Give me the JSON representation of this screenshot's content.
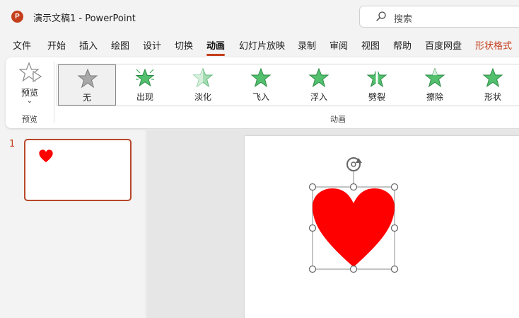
{
  "window": {
    "app_logo": "P",
    "title": "演示文稿1  -  PowerPoint"
  },
  "search": {
    "placeholder": "搜索",
    "icon": "search-icon"
  },
  "menu": {
    "tabs": [
      {
        "label": "文件"
      },
      {
        "label": "开始"
      },
      {
        "label": "插入"
      },
      {
        "label": "绘图"
      },
      {
        "label": "设计"
      },
      {
        "label": "切换"
      },
      {
        "label": "动画",
        "active": true
      },
      {
        "label": "幻灯片放映"
      },
      {
        "label": "录制"
      },
      {
        "label": "审阅"
      },
      {
        "label": "视图"
      },
      {
        "label": "帮助"
      },
      {
        "label": "百度网盘"
      },
      {
        "label": "形状格式",
        "contextual": true
      }
    ]
  },
  "ribbon": {
    "preview": {
      "label": "预览",
      "caret": "⌄",
      "group_label": "预览"
    },
    "animation_group_label": "动画",
    "effects": [
      {
        "label": "无",
        "selected": true
      },
      {
        "label": "出现"
      },
      {
        "label": "淡化"
      },
      {
        "label": "飞入"
      },
      {
        "label": "浮入"
      },
      {
        "label": "劈裂"
      },
      {
        "label": "擦除"
      },
      {
        "label": "形状"
      }
    ]
  },
  "slides_pane": {
    "slides": [
      {
        "number": "1"
      }
    ]
  },
  "colors": {
    "accent": "#c43e1c",
    "heart": "#ff0000",
    "star_green": "#3fae5c",
    "star_gray": "#9a9a9a"
  }
}
